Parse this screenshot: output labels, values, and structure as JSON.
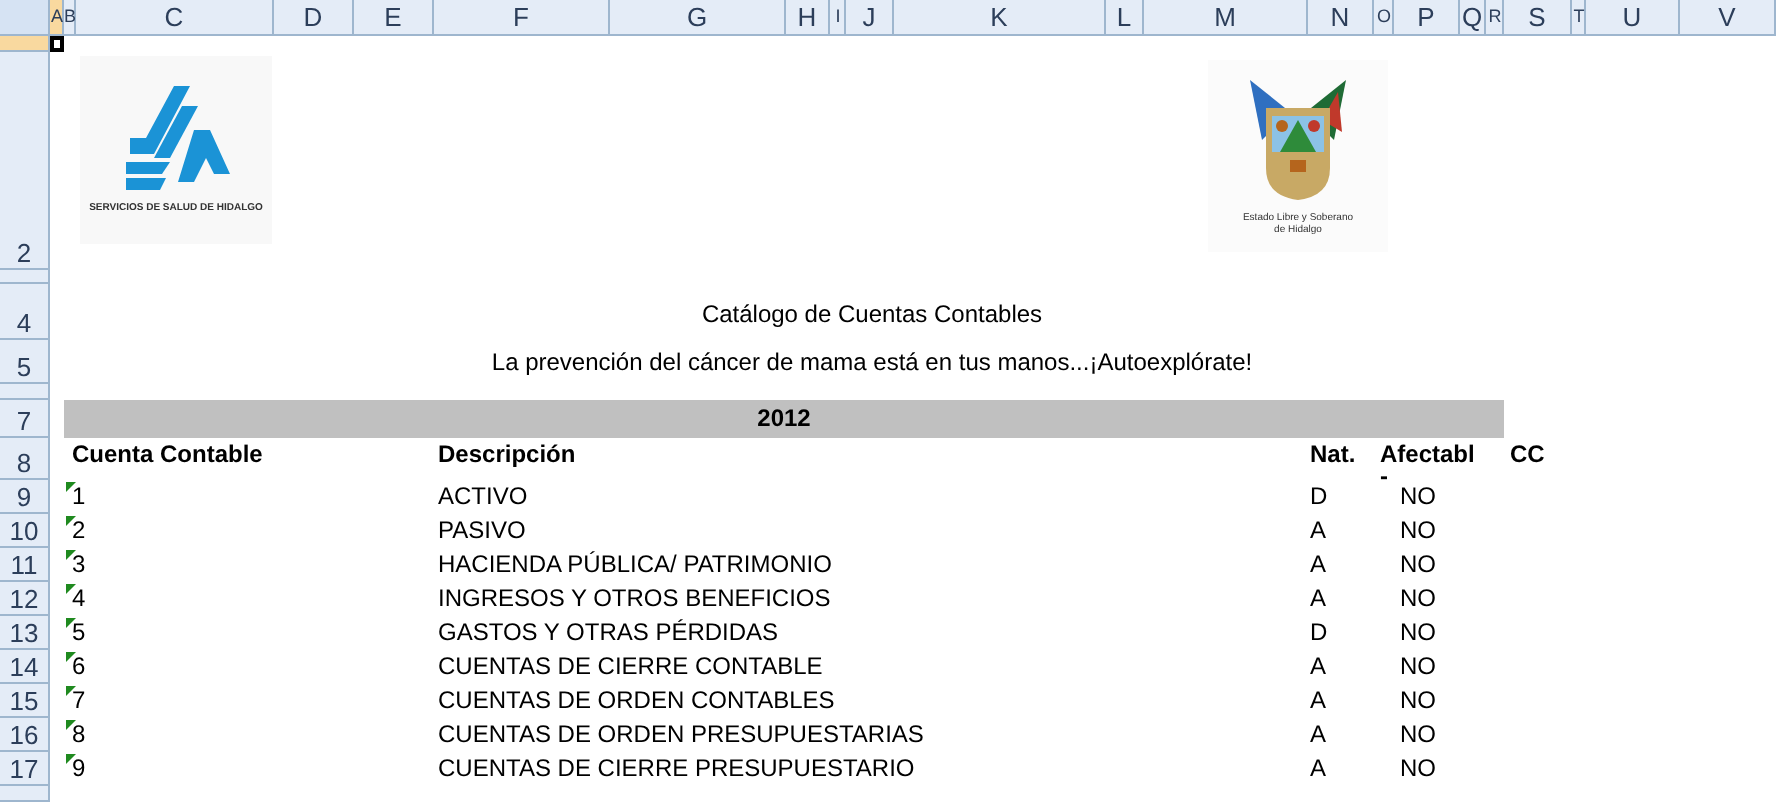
{
  "columns": [
    {
      "label": "A",
      "selected": true
    },
    {
      "label": "B",
      "selected": false
    },
    {
      "label": "C",
      "selected": false
    },
    {
      "label": "D",
      "selected": false
    },
    {
      "label": "E",
      "selected": false
    },
    {
      "label": "F",
      "selected": false
    },
    {
      "label": "G",
      "selected": false
    },
    {
      "label": "H",
      "selected": false
    },
    {
      "label": "I",
      "selected": false
    },
    {
      "label": "J",
      "selected": false
    },
    {
      "label": "K",
      "selected": false
    },
    {
      "label": "L",
      "selected": false
    },
    {
      "label": "M",
      "selected": false
    },
    {
      "label": "N",
      "selected": false
    },
    {
      "label": "O",
      "selected": false
    },
    {
      "label": "P",
      "selected": false
    },
    {
      "label": "Q",
      "selected": false
    },
    {
      "label": "R",
      "selected": false
    },
    {
      "label": "S",
      "selected": false
    },
    {
      "label": "T",
      "selected": false
    },
    {
      "label": "U",
      "selected": false
    },
    {
      "label": "V",
      "selected": false
    }
  ],
  "row_numbers": [
    {
      "selected": true
    },
    {
      "label": "2",
      "selected": false
    },
    {
      "selected": false
    },
    {
      "label": "4",
      "selected": false
    },
    {
      "label": "5",
      "selected": false
    },
    {
      "selected": false
    },
    {
      "label": "7",
      "selected": false
    },
    {
      "label": "8",
      "selected": false
    },
    {
      "label": "9",
      "selected": false
    },
    {
      "label": "10",
      "selected": false
    },
    {
      "label": "11",
      "selected": false
    },
    {
      "label": "12",
      "selected": false
    },
    {
      "label": "13",
      "selected": false
    },
    {
      "label": "14",
      "selected": false
    },
    {
      "label": "15",
      "selected": false
    },
    {
      "label": "16",
      "selected": false
    },
    {
      "label": "17",
      "selected": false
    },
    {
      "selected": false
    }
  ],
  "logos": {
    "left_caption": "SERVICIOS DE SALUD DE HIDALGO",
    "right_caption": "Estado Libre y Soberano de Hidalgo"
  },
  "title": "Catálogo de Cuentas Contables",
  "subtitle": "La prevención del cáncer de mama está en tus manos...¡Autoexplórate!",
  "band_label": "2012",
  "table": {
    "columns": [
      "Cuenta Contable",
      "Descripción",
      "Nat.",
      "Afectabl\n-",
      "CC"
    ],
    "rows": [
      {
        "account": "1",
        "description": "ACTIVO",
        "nature": "D",
        "affectable": "NO"
      },
      {
        "account": "2",
        "description": "PASIVO",
        "nature": "A",
        "affectable": "NO"
      },
      {
        "account": "3",
        "description": "HACIENDA PÚBLICA/ PATRIMONIO",
        "nature": "A",
        "affectable": "NO"
      },
      {
        "account": "4",
        "description": "INGRESOS Y OTROS BENEFICIOS",
        "nature": "A",
        "affectable": "NO"
      },
      {
        "account": "5",
        "description": "GASTOS Y OTRAS PÉRDIDAS",
        "nature": "D",
        "affectable": "NO"
      },
      {
        "account": "6",
        "description": "CUENTAS DE CIERRE CONTABLE",
        "nature": "A",
        "affectable": "NO"
      },
      {
        "account": "7",
        "description": "CUENTAS DE ORDEN CONTABLES",
        "nature": "A",
        "affectable": "NO"
      },
      {
        "account": "8",
        "description": "CUENTAS DE ORDEN PRESUPUESTARIAS",
        "nature": "A",
        "affectable": "NO"
      },
      {
        "account": "9",
        "description": "CUENTAS DE CIERRE PRESUPUESTARIO",
        "nature": "A",
        "affectable": "NO"
      }
    ]
  }
}
